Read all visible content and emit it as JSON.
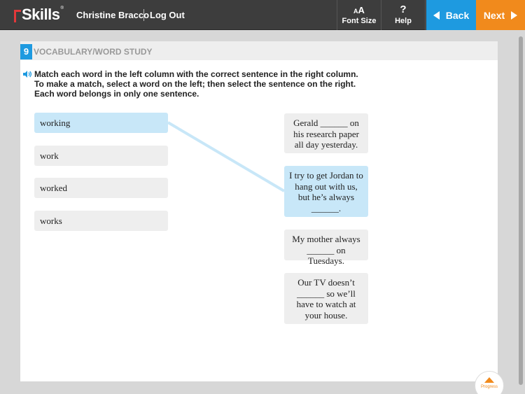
{
  "header": {
    "logo_text": "Skills",
    "logo_prefix": "r",
    "logo_reg": "®",
    "user_name": "Christine Bracco",
    "logout_label": "Log Out",
    "font_size_icon": "AA",
    "font_size_label": "Font Size",
    "help_icon": "?",
    "help_label": "Help",
    "back_label": "Back",
    "next_label": "Next"
  },
  "section": {
    "number": "9",
    "title": "VOCABULARY/WORD STUDY"
  },
  "instructions": "Match each word in the left column with the correct sentence in the right column. To make a match, select a word on the left; then select the sentence on the right. Each word belongs in only one sentence.",
  "words": [
    {
      "label": "working",
      "selected": true
    },
    {
      "label": "work",
      "selected": false
    },
    {
      "label": "worked",
      "selected": false
    },
    {
      "label": "works",
      "selected": false
    }
  ],
  "sentences": [
    {
      "text": "Gerald ______ on his research paper all day yesterday.",
      "selected": false
    },
    {
      "text": "I try to get Jordan to hang out with us, but he’s always ______.",
      "selected": true
    },
    {
      "text": "My mother always ______ on Tuesdays.",
      "selected": false
    },
    {
      "text": "Our TV doesn’t ______ so we’ll have to watch at your house.",
      "selected": false
    }
  ],
  "matches": [
    {
      "word_index": 0,
      "sentence_index": 1
    }
  ],
  "progress_label": "Progress",
  "colors": {
    "topbar": "#3d3d3d",
    "accent_blue": "#1e9ae0",
    "accent_orange": "#f18a1c",
    "logo_red": "#e2383a",
    "selected_fill": "#c8e7f8",
    "connector": "#c8e7f8"
  },
  "icons": {
    "speaker": "speaker-icon",
    "back": "back-arrow-icon",
    "next": "next-arrow-icon",
    "progress": "progress-up-icon"
  }
}
